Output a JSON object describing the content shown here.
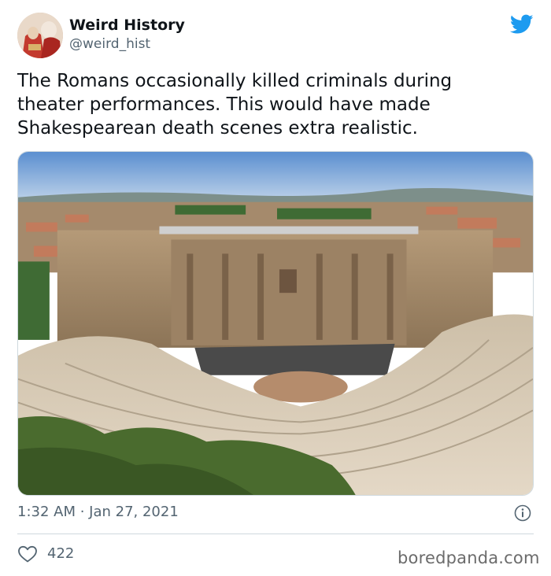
{
  "tweet": {
    "author_name": "Weird History",
    "author_handle": "@weird_hist",
    "text": "The Romans occasionally killed criminals during\ntheater performances. This would have made\nShakespearean death scenes extra realistic.",
    "timestamp": "1:32 AM · Jan 27, 2021",
    "like_count": "422"
  },
  "icons": {
    "brand": "twitter-bird-icon",
    "info": "info-icon",
    "like": "heart-icon"
  },
  "colors": {
    "twitter_blue": "#1d9bf0",
    "secondary_text": "#536471",
    "divider": "#cfd9de"
  },
  "watermark": {
    "text": "boredpanda.com"
  }
}
